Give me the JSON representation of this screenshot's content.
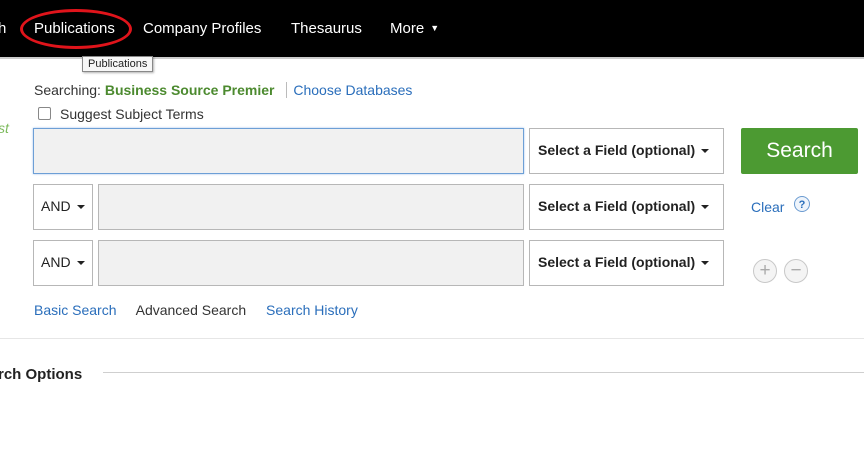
{
  "nav": {
    "items": [
      {
        "label": "h"
      },
      {
        "label": "Publications"
      },
      {
        "label": "Company Profiles"
      },
      {
        "label": "Thesaurus"
      },
      {
        "label": "More"
      }
    ],
    "more_caret": "▼"
  },
  "tooltip": {
    "text": "Publications"
  },
  "searching": {
    "prefix": "Searching:",
    "database": "Business Source Premier",
    "choose_link": "Choose Databases"
  },
  "suggest": {
    "label": "Suggest Subject Terms",
    "checked": false
  },
  "side_fragment": "st",
  "rows": [
    {
      "bool": "",
      "value": "",
      "field": "Select a Field (optional)"
    },
    {
      "bool": "AND",
      "value": "",
      "field": "Select a Field (optional)"
    },
    {
      "bool": "AND",
      "value": "",
      "field": "Select a Field (optional)"
    }
  ],
  "buttons": {
    "search": "Search",
    "clear": "Clear",
    "help": "?",
    "add": "+",
    "remove": "−"
  },
  "tabs": {
    "basic": "Basic Search",
    "advanced": "Advanced Search",
    "history": "Search History"
  },
  "options": {
    "title": "rch Options"
  },
  "colors": {
    "brand_green": "#4c9a32",
    "link_blue": "#2a6ebb",
    "highlight_red": "#e0141b"
  }
}
